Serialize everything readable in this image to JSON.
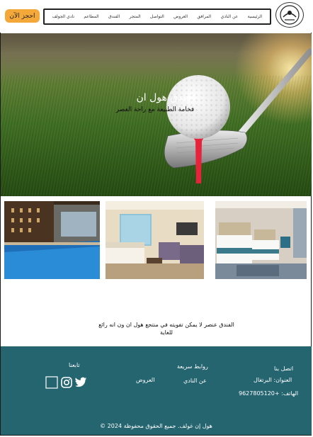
{
  "header": {
    "logo_icon": "golf-club-logo-icon",
    "nav": [
      {
        "label": "الرئيسية"
      },
      {
        "label": "عن النادي"
      },
      {
        "label": "المرافق"
      },
      {
        "label": "العروض"
      },
      {
        "label": "التواصل"
      },
      {
        "label": "المتجر"
      },
      {
        "label": "الفندق"
      },
      {
        "label": "المطاعم"
      },
      {
        "label": "نادي الجولف"
      }
    ],
    "book_button": "احجز الآن"
  },
  "hero": {
    "title": "فندق هول ان",
    "subtitle": "فخامة الطبيعة مع راحة العصر"
  },
  "gallery": {
    "images": [
      "indoor-pool-photo",
      "hotel-lounge-room-photo",
      "hotel-twin-bedroom-photo"
    ]
  },
  "intro_text": "الفندق عنصر لا يمكن تفويته في منتجع هول ان ون انه رائع للغاية",
  "footer": {
    "contact": {
      "title": "اتصل بنا",
      "address": "العنوان: البرتغال",
      "phone": "الهاتف: +9627805120"
    },
    "quick_links": {
      "title": "روابط سريعة",
      "links": [
        "عن النادي",
        "العروض"
      ]
    },
    "follow": {
      "title": "تابعنا",
      "icons": [
        "twitter-icon",
        "instagram-icon",
        "facebook-icon"
      ]
    },
    "copyright": "هول إن غولف. جميع الحقوق محفوظة 2024 ©"
  },
  "colors": {
    "footer_bg": "#256570",
    "accent": "#f4a83a"
  }
}
